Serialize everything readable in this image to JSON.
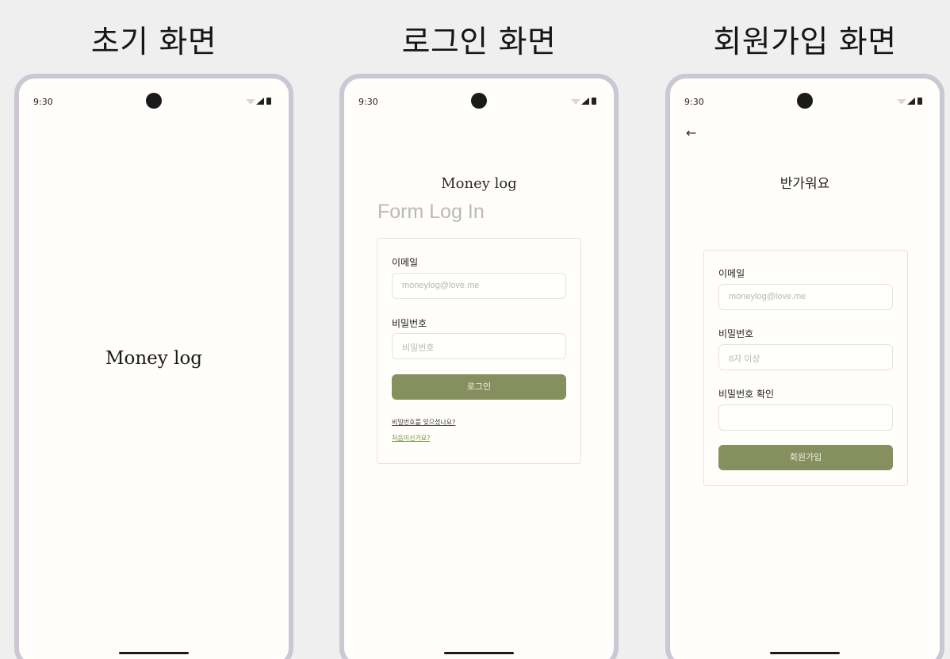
{
  "screens": {
    "initial": {
      "heading": "초기 화면",
      "app_name": "Money log"
    },
    "login": {
      "heading": "로그인 화면",
      "app_name": "Money log",
      "watermark": "Form Log In",
      "email_label": "이메일",
      "email_placeholder": "moneylog@love.me",
      "password_label": "비밀번호",
      "password_placeholder": "비밀번호",
      "login_button": "로그인",
      "forgot_password_link": "비밀번호를 잊으셨나요?",
      "first_time_link": "처음이신가요?"
    },
    "signup": {
      "heading": "회원가입 화면",
      "greeting": "반가워요",
      "email_label": "이메일",
      "email_placeholder": "moneylog@love.me",
      "password_label": "비밀번호",
      "password_placeholder": "8자 이상",
      "confirm_label": "비밀번호 확인",
      "confirm_placeholder": "",
      "signup_button": "회원가입"
    }
  },
  "status_bar": {
    "time": "9:30",
    "icons": [
      "wifi-icon",
      "signal-icon",
      "battery-icon"
    ]
  },
  "colors": {
    "background": "#efefef",
    "phone_frame": "#c9c8d3",
    "screen": "#fffefa",
    "primary_button": "#868f5e"
  }
}
